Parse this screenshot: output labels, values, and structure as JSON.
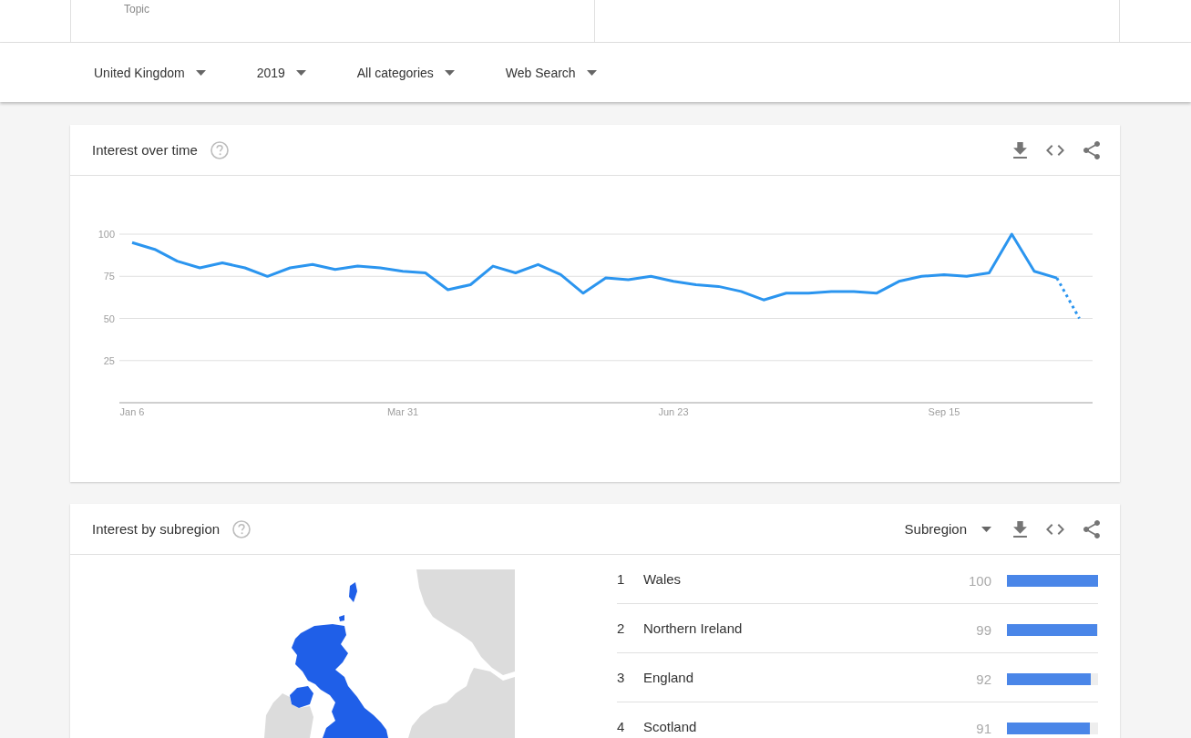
{
  "comparison_terms": [
    {
      "kind": "term",
      "subtitle": "Topic"
    },
    {
      "kind": "empty"
    }
  ],
  "filters": [
    {
      "label": "United Kingdom"
    },
    {
      "label": "2019"
    },
    {
      "label": "All categories"
    },
    {
      "label": "Web Search"
    }
  ],
  "interest_over_time": {
    "title": "Interest over time",
    "chart_data": {
      "type": "line",
      "grid": true,
      "ylim": [
        0,
        100
      ],
      "yticks": [
        25,
        50,
        75,
        100
      ],
      "categories": [
        "Jan 6",
        null,
        null,
        null,
        null,
        null,
        null,
        null,
        null,
        null,
        null,
        null,
        "Mar 31",
        null,
        null,
        null,
        null,
        null,
        null,
        null,
        null,
        null,
        null,
        null,
        "Jun 23",
        null,
        null,
        null,
        null,
        null,
        null,
        null,
        null,
        null,
        null,
        null,
        "Sep 15",
        null,
        null,
        null,
        null,
        null,
        null
      ],
      "series": [
        {
          "color": "#2b95ef",
          "line_style": "solid",
          "values": [
            95,
            91,
            84,
            80,
            83,
            80,
            75,
            80,
            82,
            79,
            81,
            80,
            78,
            77,
            67,
            70,
            81,
            77,
            82,
            76,
            65,
            74,
            73,
            75,
            72,
            70,
            69,
            66,
            61,
            65,
            65,
            66,
            66,
            65,
            72,
            75,
            76,
            75,
            77,
            100,
            78,
            74,
            null
          ]
        },
        {
          "color": "#2b95ef",
          "line_style": "dotted",
          "values": [
            null,
            null,
            null,
            null,
            null,
            null,
            null,
            null,
            null,
            null,
            null,
            null,
            null,
            null,
            null,
            null,
            null,
            null,
            null,
            null,
            null,
            null,
            null,
            null,
            null,
            null,
            null,
            null,
            null,
            null,
            null,
            null,
            null,
            null,
            null,
            null,
            null,
            null,
            null,
            null,
            null,
            74,
            50
          ]
        }
      ]
    }
  },
  "interest_by_subregion": {
    "title": "Interest by subregion",
    "resolution": "Subregion",
    "regions": [
      {
        "rank": "1",
        "name": "Wales",
        "score": "100",
        "level": 1.0
      },
      {
        "rank": "2",
        "name": "Northern Ireland",
        "score": "99",
        "level": 0.99
      },
      {
        "rank": "3",
        "name": "England",
        "score": "92",
        "level": 0.92
      },
      {
        "rank": "4",
        "name": "Scotland",
        "score": "91",
        "level": 0.91
      }
    ]
  }
}
